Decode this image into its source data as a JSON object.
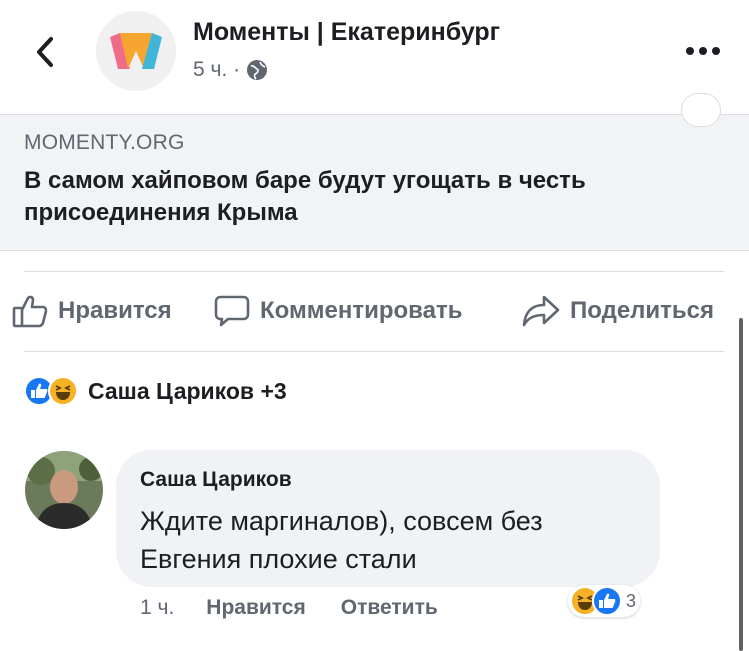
{
  "header": {
    "page_name": "Моменты | Екатеринбург",
    "time": "5 ч. ·",
    "icons": {
      "back": "chevron-left-icon",
      "globe": "globe-icon",
      "more": "more-dots-icon"
    }
  },
  "link_preview": {
    "domain": "MOMENTY.ORG",
    "title": "В самом хайповом баре будут угощать в честь присоединения Крыма"
  },
  "actions": {
    "like": "Нравится",
    "comment": "Комментировать",
    "share": "Поделиться"
  },
  "reactions_summary": {
    "types": [
      "like",
      "haha"
    ],
    "names": "Саша Цариков +3"
  },
  "comment": {
    "author": "Саша Цариков",
    "text": "Ждите маргиналов), совсем без Евгения плохие  стали",
    "time": "1 ч.",
    "like_label": "Нравится",
    "reply_label": "Ответить",
    "reaction_count": "3"
  },
  "colors": {
    "like_blue": "#1877f2",
    "haha_yellow": "#f7b125",
    "text_secondary": "#606770",
    "card_bg": "#f2f3f5"
  }
}
